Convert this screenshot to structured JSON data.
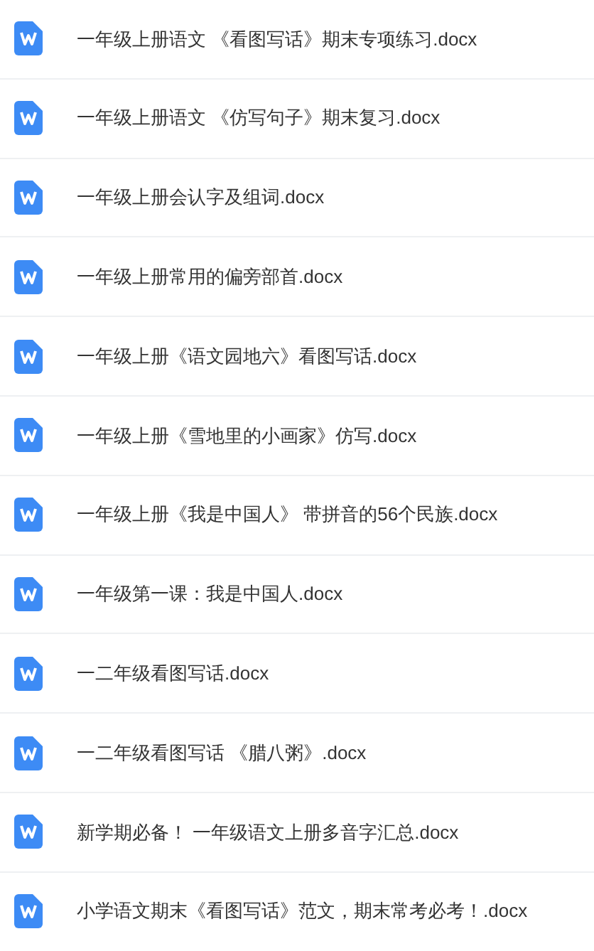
{
  "files": [
    {
      "name": "一年级上册语文 《看图写话》期末专项练习.docx"
    },
    {
      "name": "一年级上册语文 《仿写句子》期末复习.docx"
    },
    {
      "name": "一年级上册会认字及组词.docx"
    },
    {
      "name": "一年级上册常用的偏旁部首.docx"
    },
    {
      "name": "一年级上册《语文园地六》看图写话.docx"
    },
    {
      "name": "一年级上册《雪地里的小画家》仿写.docx"
    },
    {
      "name": "一年级上册《我是中国人》 带拼音的56个民族.docx"
    },
    {
      "name": "一年级第一课：我是中国人.docx"
    },
    {
      "name": "一二年级看图写话.docx"
    },
    {
      "name": "一二年级看图写话 《腊八粥》.docx"
    },
    {
      "name": "新学期必备！ 一年级语文上册多音字汇总.docx"
    },
    {
      "name": "小学语文期末《看图写话》范文，期末常考必考！.docx"
    }
  ]
}
